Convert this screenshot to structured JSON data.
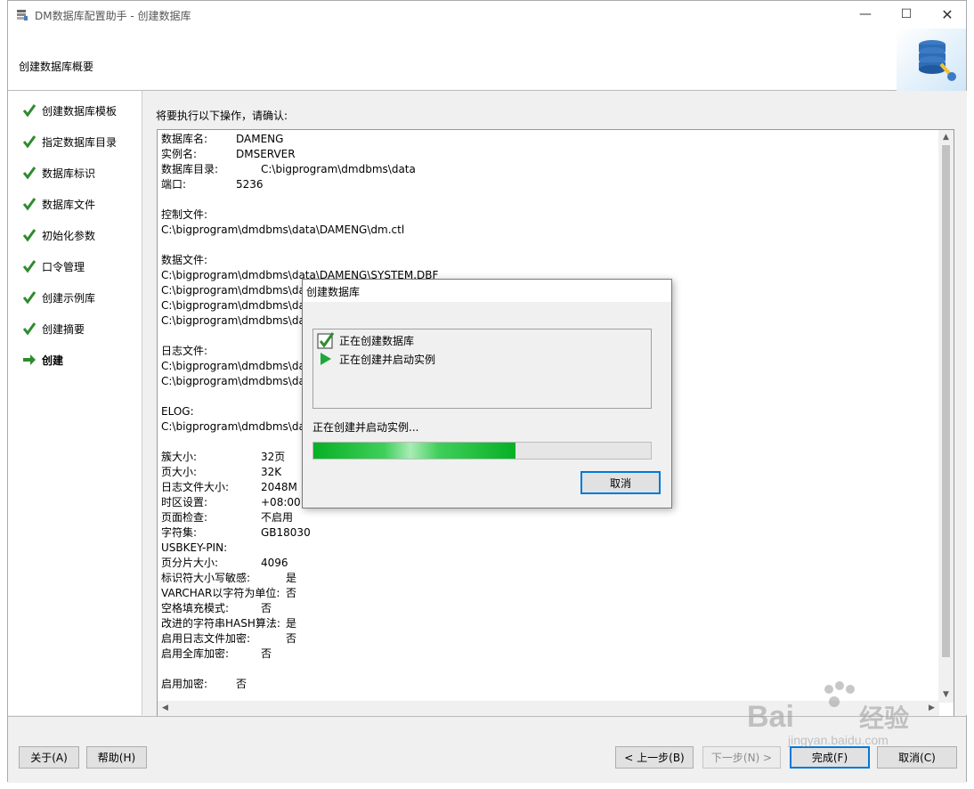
{
  "window": {
    "title": "DM数据库配置助手 - 创建数据库",
    "controls": {
      "minimize": "—",
      "maximize": "☐",
      "close": "✕"
    }
  },
  "header": {
    "title": "创建数据库概要"
  },
  "sidebar": {
    "steps": [
      {
        "label": "创建数据库模板",
        "state": "done"
      },
      {
        "label": "指定数据库目录",
        "state": "done"
      },
      {
        "label": "数据库标识",
        "state": "done"
      },
      {
        "label": "数据库文件",
        "state": "done"
      },
      {
        "label": "初始化参数",
        "state": "done"
      },
      {
        "label": "口令管理",
        "state": "done"
      },
      {
        "label": "创建示例库",
        "state": "done"
      },
      {
        "label": "创建摘要",
        "state": "done"
      },
      {
        "label": "创建",
        "state": "current"
      }
    ]
  },
  "main": {
    "confirm_text": "将要执行以下操作，请确认:",
    "summary": {
      "db_name": {
        "k": "数据库名:",
        "v": "DAMENG"
      },
      "instance": {
        "k": "实例名:",
        "v": "DMSERVER"
      },
      "db_dir": {
        "k": "数据库目录:",
        "v": "C:\\bigprogram\\dmdbms\\data"
      },
      "port": {
        "k": "端口:",
        "v": "5236"
      },
      "ctl_label": "控制文件:",
      "ctl_path": "C:\\bigprogram\\dmdbms\\data\\DAMENG\\dm.ctl",
      "data_label": "数据文件:",
      "data_path1": "C:\\bigprogram\\dmdbms\\data\\DAMENG\\SYSTEM.DBF",
      "data_path_trunc": "C:\\bigprogram\\dmdbms\\da",
      "log_label": "日志文件:",
      "elog_label": "ELOG:",
      "extent_size": {
        "k": "簇大小:",
        "v": "32页"
      },
      "page_size": {
        "k": "页大小:",
        "v": "32K"
      },
      "log_size": {
        "k": "日志文件大小:",
        "v": "2048M"
      },
      "timezone": {
        "k": "时区设置:",
        "v": "+08:00"
      },
      "page_check": {
        "k": "页面检查:",
        "v": "不启用"
      },
      "charset": {
        "k": "字符集:",
        "v": "GB18030"
      },
      "usbkey": {
        "k": "USBKEY-PIN:",
        "v": ""
      },
      "page_shard": {
        "k": "页分片大小:",
        "v": "4096"
      },
      "case_sensitive": {
        "k": "标识符大小写敏感:",
        "v": "是"
      },
      "varchar_char": {
        "k": "VARCHAR以字符为单位:",
        "v": "否"
      },
      "blank_pad": {
        "k": "空格填充模式:",
        "v": "否"
      },
      "hash_algo": {
        "k": "改进的字符串HASH算法:",
        "v": "是"
      },
      "log_encrypt": {
        "k": "启用日志文件加密:",
        "v": "否"
      },
      "full_encrypt": {
        "k": "启用全库加密:",
        "v": "否"
      },
      "encrypt": {
        "k": "启用加密:",
        "v": "否"
      }
    }
  },
  "footer": {
    "about": "关于(A)",
    "help": "帮助(H)",
    "prev": "< 上一步(B)",
    "next": "下一步(N) >",
    "finish": "完成(F)",
    "cancel": "取消(C)"
  },
  "dialog": {
    "title": "创建数据库",
    "tasks": [
      {
        "label": "正在创建数据库",
        "state": "done"
      },
      {
        "label": "正在创建并启动实例",
        "state": "running"
      }
    ],
    "status": "正在创建并启动实例...",
    "progress": 0.6,
    "cancel": "取消"
  },
  "watermark": {
    "brand": "Bai",
    "brand2": "经验",
    "url": "jingyan.baidu.com"
  },
  "colors": {
    "accent": "#0078d7",
    "check": "#2e8b2e",
    "progress": "#06b025"
  }
}
